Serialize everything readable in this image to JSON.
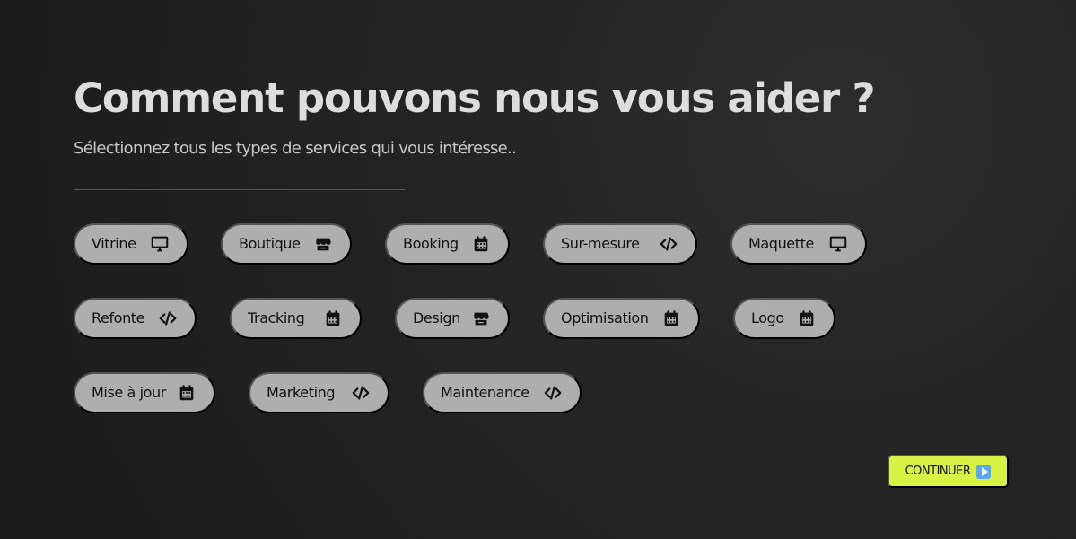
{
  "page": {
    "title": "Comment pouvons nous vous aider ?",
    "subtitle": "Sélectionnez tous les types de services qui vous intéresse.."
  },
  "services": [
    {
      "label": "Vitrine",
      "icon": "monitor-icon"
    },
    {
      "label": "Boutique",
      "icon": "store-icon"
    },
    {
      "label": "Booking",
      "icon": "calendar-icon"
    },
    {
      "label": "Sur-mesure",
      "icon": "code-icon"
    },
    {
      "label": "Maquette",
      "icon": "monitor-icon"
    },
    {
      "label": "Refonte",
      "icon": "code-icon"
    },
    {
      "label": "Tracking",
      "icon": "calendar-icon"
    },
    {
      "label": "Design",
      "icon": "store-icon"
    },
    {
      "label": "Optimisation",
      "icon": "calendar-icon"
    },
    {
      "label": "Logo",
      "icon": "calendar-icon"
    },
    {
      "label": "Mise à jour",
      "icon": "calendar-icon"
    },
    {
      "label": "Marketing",
      "icon": "code-icon"
    },
    {
      "label": "Maintenance",
      "icon": "code-icon"
    }
  ],
  "actions": {
    "continue_label": "CONTINUER",
    "continue_icon": "play-icon"
  },
  "colors": {
    "background": "#222222",
    "chip_background": "#aeaeae",
    "chip_text": "#111111",
    "title_text": "#dddddd",
    "accent": "#d8f244"
  }
}
